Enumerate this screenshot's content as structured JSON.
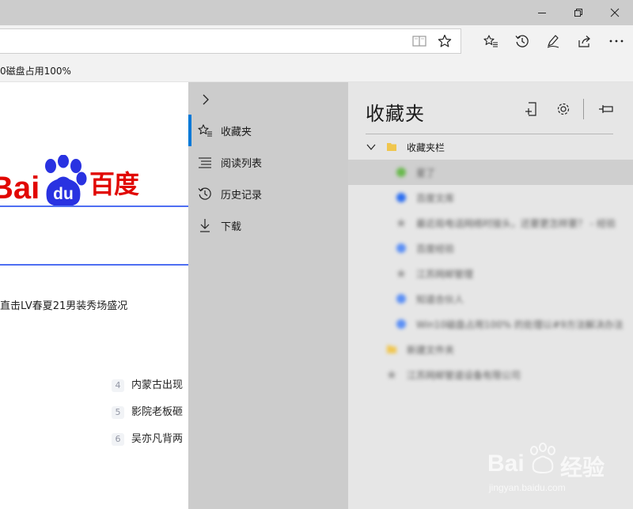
{
  "window": {
    "controls": {
      "minimize": "minimize-icon",
      "restore": "restore-icon",
      "close": "close-icon"
    }
  },
  "toolbar": {
    "icons": [
      "reading-view-icon",
      "star-icon",
      "favorites-list-icon",
      "history-icon",
      "pen-icon",
      "share-icon",
      "more-icon"
    ]
  },
  "favorites_bar": {
    "item": "0磁盘占用100%"
  },
  "page": {
    "logo": {
      "latin_part": "Bai",
      "du_part": "du",
      "chinese_part": "百度"
    },
    "headline": "直击LV春夏21男装秀场盛况",
    "hot_list": [
      {
        "num": "4",
        "text": "内蒙古出现"
      },
      {
        "num": "5",
        "text": "影院老板砸"
      },
      {
        "num": "6",
        "text": "吴亦凡背两"
      }
    ],
    "colors": {
      "baidu_red": "#e10601",
      "baidu_blue": "#2932e1",
      "search_line": "#4e6ef2"
    }
  },
  "hub": {
    "nav": [
      {
        "label": "收藏夹",
        "icon": "favorites-icon",
        "active": true
      },
      {
        "label": "阅读列表",
        "icon": "reading-list-icon",
        "active": false
      },
      {
        "label": "历史记录",
        "icon": "history-icon",
        "active": false
      },
      {
        "label": "下载",
        "icon": "download-icon",
        "active": false
      }
    ],
    "accent": "#0078d7"
  },
  "favorites_panel": {
    "title": "收藏夹",
    "actions": [
      "add-to-favorites-icon",
      "settings-icon",
      "pin-icon"
    ],
    "folder": {
      "label": "收藏夹栏",
      "expanded": true
    },
    "items": [
      {
        "text": "星了",
        "icon": "green-circle-icon",
        "blurred": true,
        "selected": true
      },
      {
        "text": "百度文库",
        "icon": "baidu-paw-icon",
        "blurred": true,
        "selected": false
      },
      {
        "text": "最近局电话网络时接头，还要更怎样要？ - 经验",
        "icon": "globe-icon",
        "blurred": true,
        "selected": false
      },
      {
        "text": "百度经验",
        "icon": "paw-icon",
        "blurred": true,
        "selected": false
      },
      {
        "text": "江苏网邮管理",
        "icon": "globe-icon",
        "blurred": true,
        "selected": false
      },
      {
        "text": "知道合伙人",
        "icon": "paw-icon",
        "blurred": true,
        "selected": false
      },
      {
        "text": "Win10磁盘占用100% 的处理以#9方法解决办法",
        "icon": "paw-icon",
        "blurred": true,
        "selected": false
      },
      {
        "text": "新建文件夹",
        "icon": "folder-icon",
        "blurred": true,
        "selected": false
      },
      {
        "text": "江苏网邮管道设备有限公司",
        "icon": "globe-icon",
        "blurred": true,
        "selected": false
      }
    ]
  },
  "watermark": {
    "brand_latin": "Bai",
    "brand_cn": "经验",
    "url": "jingyan.baidu.com"
  }
}
